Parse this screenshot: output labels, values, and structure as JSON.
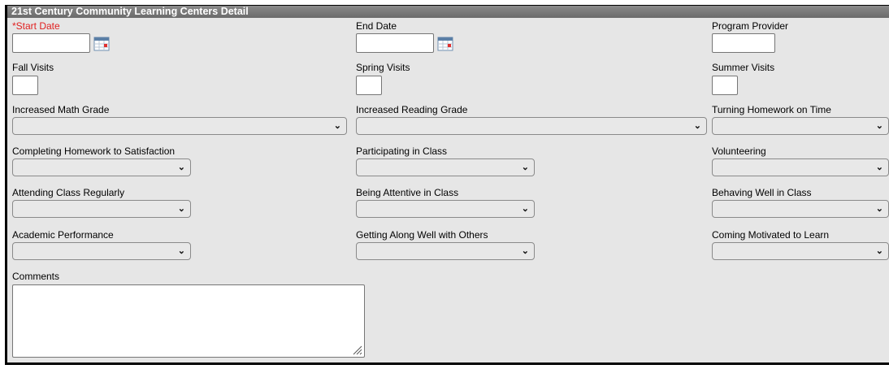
{
  "panel": {
    "title": "21st Century Community Learning Centers Detail"
  },
  "fields": {
    "start_date": {
      "label": "*Start Date",
      "value": ""
    },
    "end_date": {
      "label": "End Date",
      "value": ""
    },
    "program_provider": {
      "label": "Program Provider",
      "value": ""
    },
    "fall_visits": {
      "label": "Fall Visits",
      "value": ""
    },
    "spring_visits": {
      "label": "Spring Visits",
      "value": ""
    },
    "summer_visits": {
      "label": "Summer Visits",
      "value": ""
    },
    "increased_math_grade": {
      "label": "Increased Math Grade",
      "value": ""
    },
    "increased_reading_grade": {
      "label": "Increased Reading Grade",
      "value": ""
    },
    "turning_homework_on_time": {
      "label": "Turning Homework on Time",
      "value": ""
    },
    "completing_homework": {
      "label": "Completing Homework to Satisfaction",
      "value": ""
    },
    "participating_in_class": {
      "label": "Participating in Class",
      "value": ""
    },
    "volunteering": {
      "label": "Volunteering",
      "value": ""
    },
    "attending_class_regularly": {
      "label": "Attending Class Regularly",
      "value": ""
    },
    "being_attentive": {
      "label": "Being Attentive in Class",
      "value": ""
    },
    "behaving_well": {
      "label": "Behaving Well in Class",
      "value": ""
    },
    "academic_performance": {
      "label": "Academic Performance",
      "value": ""
    },
    "getting_along": {
      "label": "Getting Along Well with Others",
      "value": ""
    },
    "coming_motivated": {
      "label": "Coming Motivated to Learn",
      "value": ""
    },
    "comments": {
      "label": "Comments",
      "value": ""
    }
  },
  "icons": {
    "calendar": "calendar-icon",
    "dropdown": "chevron-down-icon",
    "resize": "resize-grip-icon"
  },
  "colors": {
    "required_label": "#e02020",
    "titlebar": "#777777",
    "panel_bg": "#e6e6e6"
  }
}
